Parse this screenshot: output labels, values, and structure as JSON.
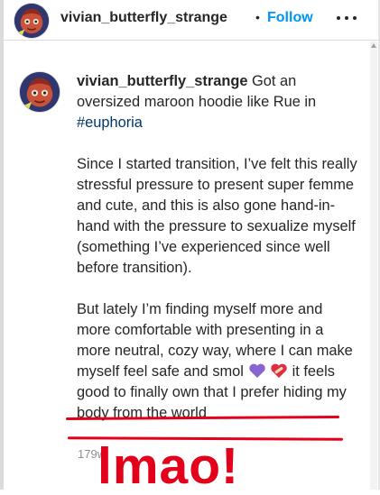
{
  "header": {
    "username": "vivian_butterfly_strange",
    "separator": "•",
    "follow_label": "Follow"
  },
  "caption": {
    "username": "vivian_butterfly_strange",
    "intro": "Got an oversized maroon hoodie like Rue in",
    "hashtag": "#euphoria",
    "paragraph_2": "Since I started transition, I’ve felt this really stressful pressure to present super femme and cute, and this is also gone hand-in-hand with the pressure to sexualize myself (something I’ve experienced since well before transition).",
    "paragraph_3_before_emoji": "But lately I’m finding myself more and more comfortable with presenting in a more neutral, cozy way, where I can make myself feel safe and smol",
    "paragraph_3_after_emoji": "it feels good to finally own that I prefer hiding my body from the world",
    "emojis": [
      "purple-heart-icon",
      "mending-heart-icon"
    ]
  },
  "timestamp": "179w",
  "overlay_text": "lmao!",
  "colors": {
    "follow_blue": "#0095f6",
    "hashtag": "#00376b",
    "annotation_red": "#e3001b",
    "purple_heart": "#8a63d2",
    "mending_heart": "#dd2e44"
  }
}
